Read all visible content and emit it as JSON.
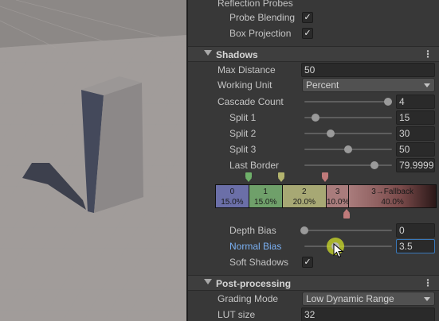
{
  "rendering": {
    "reflection_probes": {
      "header": "Reflection Probes",
      "probe_blending": {
        "label": "Probe Blending",
        "checked": "✓"
      },
      "box_projection": {
        "label": "Box Projection",
        "checked": "✓"
      }
    }
  },
  "shadows": {
    "title": "Shadows",
    "menu_glyph": "⋮",
    "max_distance": {
      "label": "Max Distance",
      "value": "50"
    },
    "working_unit": {
      "label": "Working Unit",
      "value": "Percent"
    },
    "cascade_count": {
      "label": "Cascade Count",
      "value": "4",
      "slider": 0.95
    },
    "split1": {
      "label": "Split 1",
      "value": "15",
      "slider": 0.13
    },
    "split2": {
      "label": "Split 2",
      "value": "30",
      "slider": 0.3
    },
    "split3": {
      "label": "Split 3",
      "value": "50",
      "slider": 0.5
    },
    "last_border": {
      "label": "Last Border",
      "value": "79.9999",
      "slider": 0.8
    },
    "cascade_segments": [
      {
        "name": "0",
        "percent": "15.0%",
        "color": "#6b6fa8",
        "share": 15.0
      },
      {
        "name": "1",
        "percent": "15.0%",
        "color": "#6fa06a",
        "share": 15.0
      },
      {
        "name": "2",
        "percent": "20.0%",
        "color": "#a7a874",
        "share": 20.0
      },
      {
        "name": "3",
        "percent": "10.0%",
        "color": "#a97c7c",
        "share": 10.0
      },
      {
        "name": "3→Fallback",
        "percent": "40.0%",
        "color": "#7a4a4a",
        "share": 40.0
      }
    ],
    "marker_colors": [
      "#6fb06a",
      "#b3b46e",
      "#c07b7b",
      "#c07b7b"
    ],
    "depth_bias": {
      "label": "Depth Bias",
      "value": "0",
      "slider": 0.0
    },
    "normal_bias": {
      "label": "Normal Bias",
      "value": "3.5",
      "slider": 0.35
    },
    "soft_shadows": {
      "label": "Soft Shadows",
      "checked": "✓"
    }
  },
  "post_processing": {
    "title": "Post-processing",
    "menu_glyph": "⋮",
    "grading_mode": {
      "label": "Grading Mode",
      "value": "Low Dynamic Range"
    },
    "lut_size": {
      "label": "LUT size",
      "value": "32"
    }
  },
  "icons": {
    "foldout": "triangle-down-icon",
    "menu": "kebab-menu-icon",
    "checkbox": "checkmark-icon",
    "cursor": "pointer-cursor-icon"
  }
}
